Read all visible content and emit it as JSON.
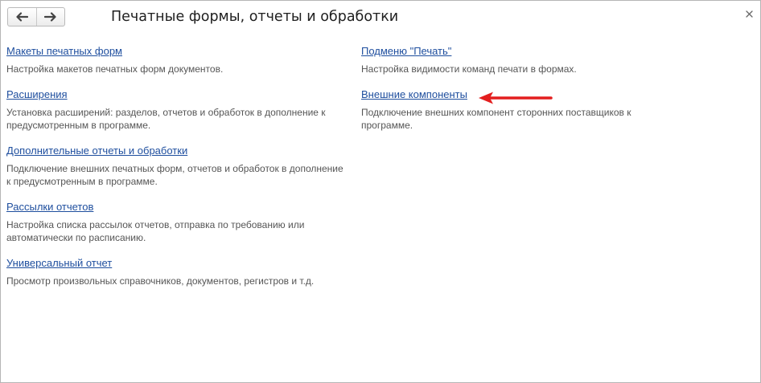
{
  "window": {
    "title": "Печатные формы, отчеты и обработки"
  },
  "left_items": [
    {
      "link": "Макеты печатных форм",
      "description": "Настройка макетов печатных форм документов."
    },
    {
      "link": "Расширения",
      "description": "Установка расширений: разделов, отчетов и обработок в дополнение к предусмотренным в программе."
    },
    {
      "link": "Дополнительные отчеты и обработки",
      "description": "Подключение внешних печатных форм, отчетов и обработок в дополнение к предусмотренным в программе."
    },
    {
      "link": "Рассылки отчетов",
      "description": "Настройка списка рассылок отчетов, отправка по требованию или автоматически по расписанию."
    },
    {
      "link": "Универсальный отчет",
      "description": "Просмотр произвольных справочников, документов, регистров и т.д."
    }
  ],
  "right_items": [
    {
      "link": "Подменю \"Печать\"",
      "description": "Настройка видимости команд печати в формах."
    },
    {
      "link": "Внешние компоненты",
      "description": "Подключение внешних компонент сторонних поставщиков к программе."
    }
  ],
  "colors": {
    "link": "#1e4e9e",
    "description": "#555555",
    "annotation_arrow": "#e31e1e"
  },
  "icons": {
    "back": "arrow-left-icon",
    "forward": "arrow-right-icon",
    "close": "close-icon"
  }
}
